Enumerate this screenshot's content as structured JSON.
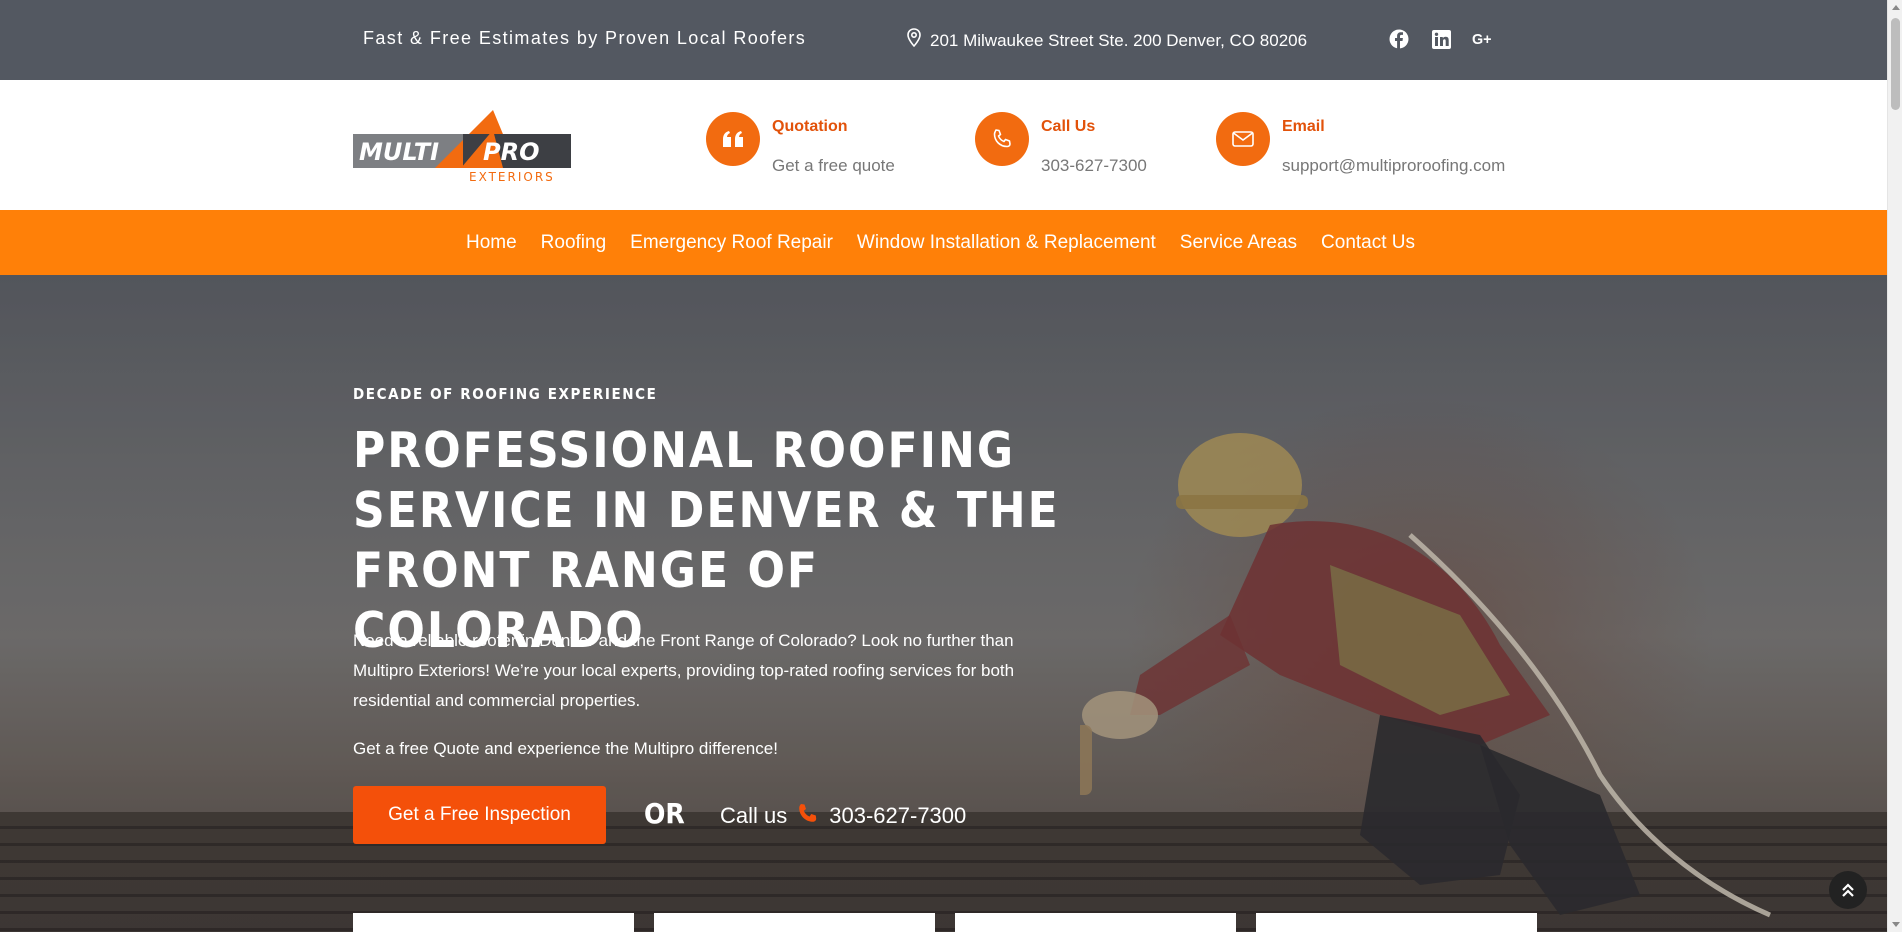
{
  "topbar": {
    "tagline": "Fast & Free Estimates by Proven Local Roofers",
    "address": "201 Milwaukee Street Ste. 200 Denver, CO 80206",
    "social": [
      "facebook-icon",
      "linkedin-icon",
      "google-plus-icon"
    ]
  },
  "header": {
    "logo_text": "MULTI PRO EXTERIORS",
    "quotation": {
      "title": "Quotation",
      "value": "Get a free quote"
    },
    "call": {
      "title": "Call Us",
      "value": "303-627-7300"
    },
    "email": {
      "title": "Email",
      "value": "support@multiproroofing.com"
    }
  },
  "nav": {
    "items": [
      "Home",
      "Roofing",
      "Emergency Roof Repair",
      "Window Installation & Replacement",
      "Service Areas",
      "Contact Us"
    ]
  },
  "hero": {
    "eyebrow": "DECADE OF ROOFING EXPERIENCE",
    "headline": "PROFESSIONAL ROOFING SERVICE IN DENVER & THE FRONT RANGE OF COLORADO",
    "description": "Need a reliable roofer in Denver and the Front Range of Colorado? Look no further than Multipro Exteriors! We’re your local experts, providing top-rated roofing services for both residential and commercial properties.",
    "description2": "Get a free Quote and experience the Multipro difference!",
    "cta_label": "Get a Free Inspection",
    "or_label": "OR",
    "call_label": "Call us",
    "phone": "303-627-7300"
  },
  "colors": {
    "topbar": "#535861",
    "nav": "#ff8008",
    "accent": "#f26b10",
    "cta": "#f4500a"
  }
}
